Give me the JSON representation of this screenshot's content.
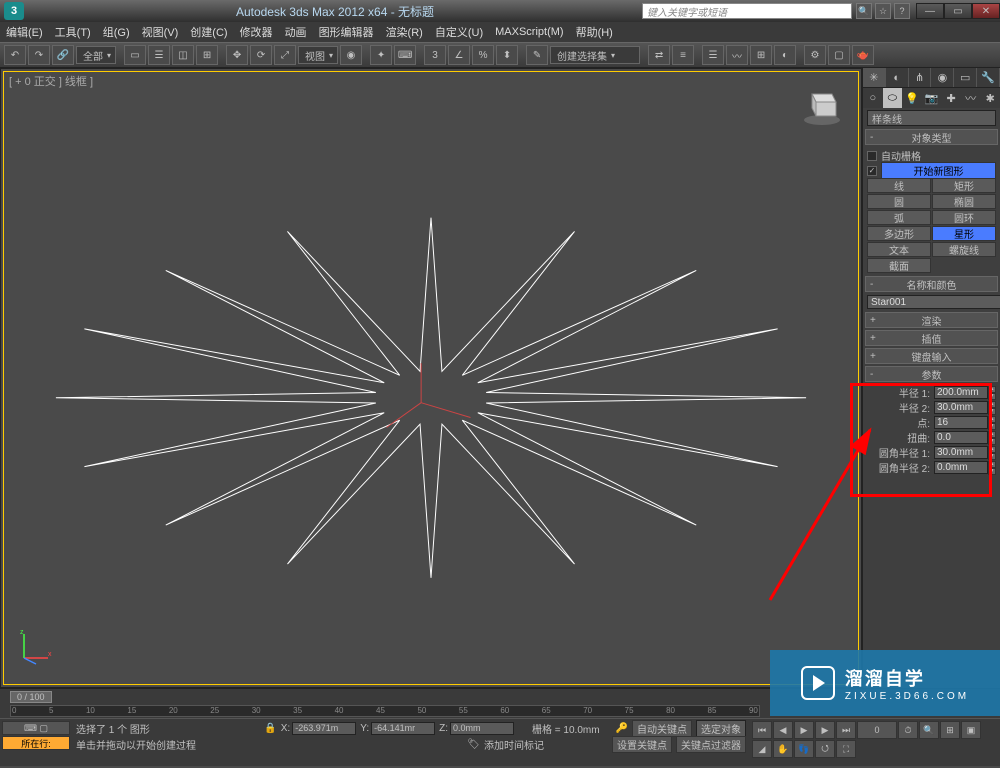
{
  "title": "Autodesk 3ds Max 2012 x64  -  无标题",
  "search_placeholder": "键入关键字或短语",
  "menu": [
    "编辑(E)",
    "工具(T)",
    "组(G)",
    "视图(V)",
    "创建(C)",
    "修改器",
    "动画",
    "图形编辑器",
    "渲染(R)",
    "自定义(U)",
    "MAXScript(M)",
    "帮助(H)"
  ],
  "viewport_label": "[ + 0 正交 ] 线框 ]",
  "toolbar_dropdowns": {
    "all": "全部",
    "view": "视图",
    "select_set": "创建选择集"
  },
  "command_panel": {
    "category": "样条线",
    "rollouts": {
      "object_type": "对象类型",
      "auto_grid": "自动栅格",
      "start_new": "开始新图形",
      "name_color": "名称和颜色",
      "render": "渲染",
      "interpolation": "插值",
      "keyboard": "键盘输入",
      "params": "参数"
    },
    "shapes": [
      [
        "线",
        "矩形"
      ],
      [
        "圆",
        "椭圆"
      ],
      [
        "弧",
        "圆环"
      ],
      [
        "多边形",
        "星形"
      ],
      [
        "文本",
        "螺旋线"
      ],
      [
        "截面",
        ""
      ]
    ],
    "name_value": "Star001",
    "params": [
      {
        "label": "半径 1:",
        "value": "200.0mm"
      },
      {
        "label": "半径 2:",
        "value": "30.0mm"
      },
      {
        "label": "点:",
        "value": "16"
      },
      {
        "label": "扭曲:",
        "value": "0.0"
      },
      {
        "label": "圆角半径 1:",
        "value": "30.0mm"
      },
      {
        "label": "圆角半径 2:",
        "value": "0.0mm"
      }
    ]
  },
  "status": {
    "selection": "选择了 1 个 图形",
    "hint": "单击并拖动以开始创建过程",
    "add_time": "添加时间标记",
    "location": "所在行:",
    "x": "-263.971m",
    "y": "-64.141mr",
    "z": "0.0mm",
    "grid": "栅格 = 10.0mm",
    "auto_key": "自动关键点",
    "set_key": "设置关键点",
    "selected_filter": "选定对象",
    "key_filter": "关键点过滤器",
    "slider": "0 / 100"
  },
  "timeline_ticks": [
    "0",
    "5",
    "10",
    "15",
    "20",
    "25",
    "30",
    "35",
    "40",
    "45",
    "50",
    "55",
    "60",
    "65",
    "70",
    "75",
    "80",
    "85",
    "90"
  ],
  "watermark": {
    "big": "溜溜自学",
    "small": "ZIXUE.3D66.COM"
  },
  "chart_data": {
    "type": "star-spline",
    "points": 16,
    "radius1": 200.0,
    "radius2": 30.0,
    "distortion": 0.0,
    "fillet_radius1": 30.0,
    "fillet_radius2": 0.0,
    "units": "mm"
  }
}
